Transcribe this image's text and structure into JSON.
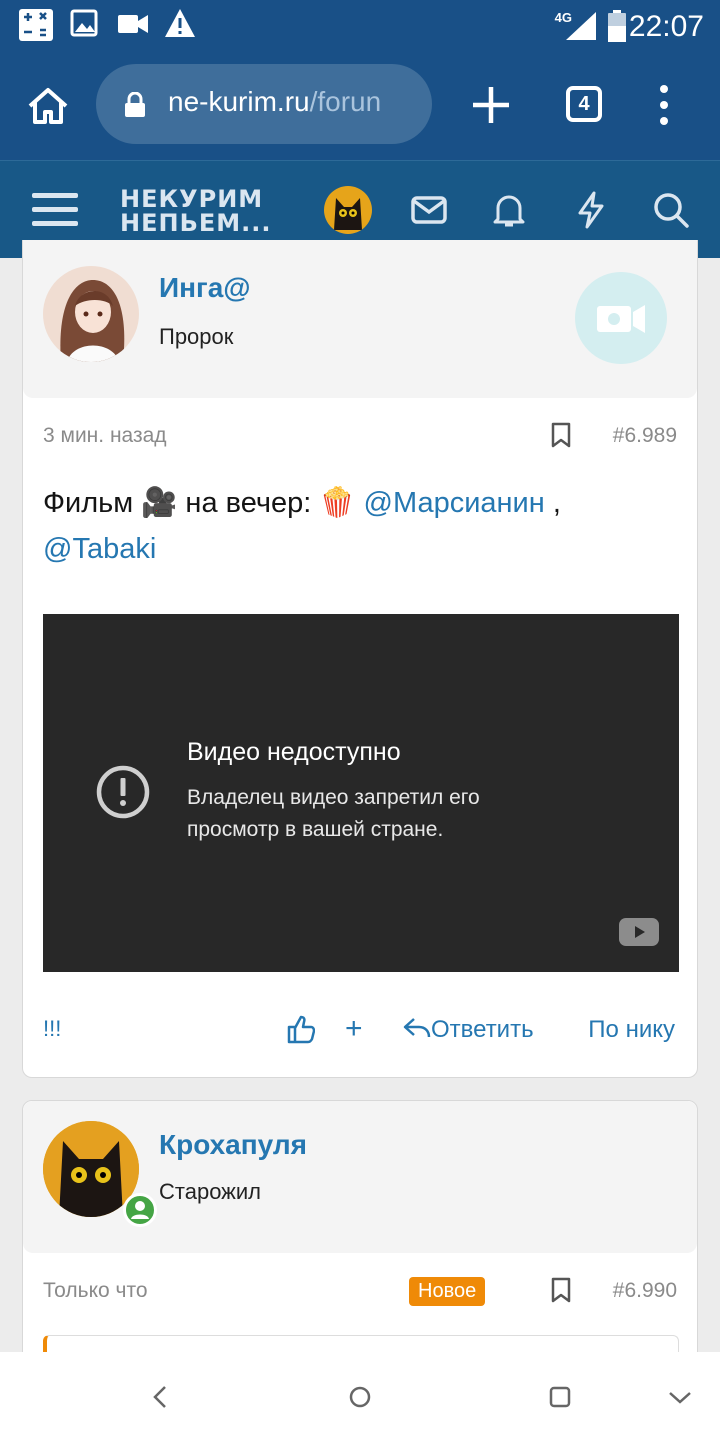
{
  "status_bar": {
    "time": "22:07",
    "network": "4G",
    "icons": [
      "calculator-icon",
      "image-icon",
      "video-icon",
      "warning-icon",
      "signal-icon",
      "battery-icon"
    ]
  },
  "browser": {
    "url_main": "ne-kurim.ru",
    "url_path": "/forun",
    "tab_count": "4"
  },
  "site": {
    "logo_line1": "НЕКУРИМ",
    "logo_line2": "НЕПЬЕМ..."
  },
  "posts": [
    {
      "username": "Инга@",
      "user_title": "Пророк",
      "time": "3 мин. назад",
      "number": "#6.989",
      "text_prefix": "Фильм 🎥 на вечер: 🍿 ",
      "mention1": "@Марсианин",
      "separator": " ,",
      "mention2": "@Tabaki",
      "video": {
        "title": "Видео недоступно",
        "message": "Владелец видео запретил его просмотр в вашей стране."
      },
      "actions": {
        "exclaim": "!!!",
        "plus": "+",
        "reply": "Ответить",
        "by_nick": "По нику"
      }
    },
    {
      "username": "Крохапуля",
      "user_title": "Старожил",
      "time": "Только что",
      "badge": "Новое",
      "number": "#6.990"
    }
  ],
  "colors": {
    "header": "#195087",
    "link": "#2577b1",
    "new_badge": "#ef8a07"
  }
}
